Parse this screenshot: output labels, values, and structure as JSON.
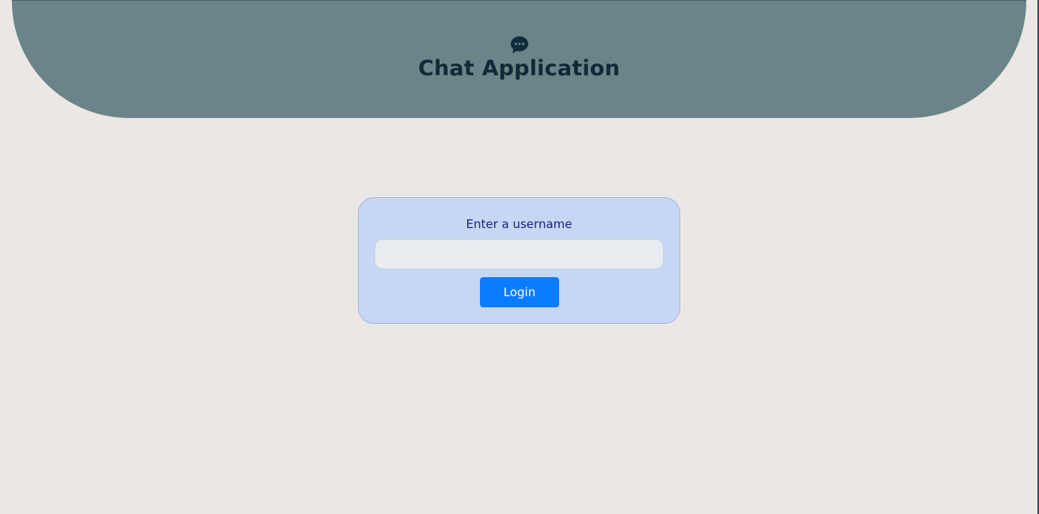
{
  "header": {
    "icon": "chat-bubble-icon",
    "title": "Chat Application"
  },
  "login": {
    "label": "Enter a username",
    "input_value": "",
    "input_placeholder": "",
    "button_label": "Login"
  },
  "colors": {
    "page_background": "#ebe7e5",
    "header_background": "#6a8488",
    "header_text": "#0f2a38",
    "card_background": "#c6d6f5",
    "card_border": "#a8b6d8",
    "label_text": "#1c1f7a",
    "input_background": "#e9edf1",
    "button_background": "#0a7cff",
    "button_text": "#ffffff"
  }
}
